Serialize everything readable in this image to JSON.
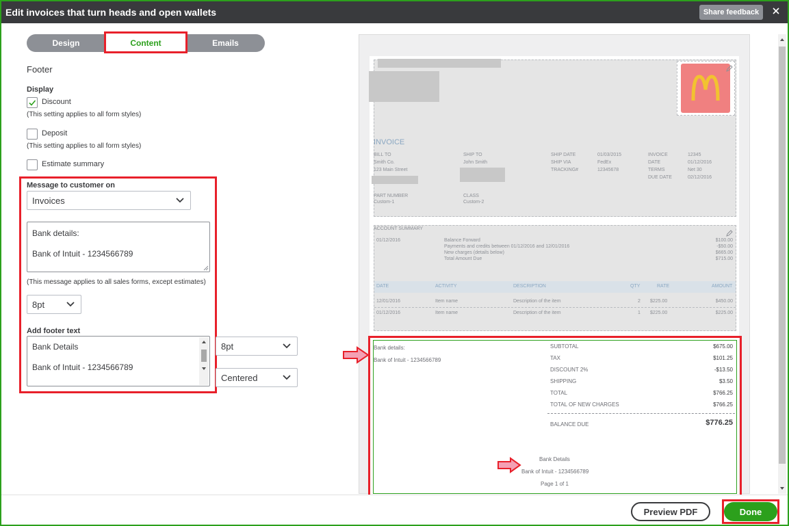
{
  "window": {
    "title": "Edit invoices that turn heads and open wallets",
    "share_feedback": "Share feedback",
    "close_icon": "close-icon"
  },
  "tabs": [
    {
      "label": "Design"
    },
    {
      "label": "Content",
      "active": true
    },
    {
      "label": "Emails"
    }
  ],
  "section": {
    "title": "Footer"
  },
  "display": {
    "heading": "Display",
    "discount": {
      "label": "Discount",
      "checked": true,
      "note": "(This setting applies to all form styles)"
    },
    "deposit": {
      "label": "Deposit",
      "checked": false,
      "note": "(This setting applies to all form styles)"
    },
    "estimate_summary": {
      "label": "Estimate summary",
      "checked": false
    }
  },
  "message": {
    "heading": "Message to customer on",
    "form_select": "Invoices",
    "text_line1": "Bank details:",
    "text_line2": "Bank of Intuit - 1234566789",
    "note": "(This message applies to all sales forms, except estimates)",
    "font_size": "8pt"
  },
  "footer_text": {
    "heading": "Add footer text",
    "line1": "Bank Details",
    "line2": "Bank of Intuit - 1234566789",
    "font_size": "8pt",
    "alignment": "Centered"
  },
  "preview": {
    "invoice_title": "INVOICE",
    "bill_to_label": "BILL TO",
    "bill_to_line1": "Smith Co.",
    "bill_to_line2": "123 Main Street",
    "ship_to_label": "SHIP TO",
    "ship_to_line1": "John Smith",
    "meta_labels": [
      "SHIP DATE",
      "SHIP VIA",
      "TRACKING#"
    ],
    "meta_values": [
      "01/03/2015",
      "FedEx",
      "12345678"
    ],
    "meta2_labels": [
      "INVOICE",
      "DATE",
      "TERMS",
      "DUE DATE"
    ],
    "meta2_values": [
      "12345",
      "01/12/2016",
      "Net 30",
      "02/12/2016"
    ],
    "part_number_label": "PART NUMBER",
    "part_number_value": "Custom-1",
    "class_label": "CLASS",
    "class_value": "Custom-2",
    "account_summary_label": "ACCOUNT SUMMARY",
    "summary_date": "01/12/2016",
    "summary_items": [
      {
        "label": "Balance Forward",
        "amount": "$100.00"
      },
      {
        "label": "Payments and credits between 01/12/2016 and 12/01/2016",
        "amount": "-$50.00"
      },
      {
        "label": "New charges (details below)",
        "amount": "$665.00"
      },
      {
        "label": "Total Amount Due",
        "amount": "$715.00"
      }
    ],
    "table_headers": [
      "DATE",
      "ACTIVITY",
      "DESCRIPTION",
      "QTY",
      "RATE",
      "AMOUNT"
    ],
    "table_rows": [
      {
        "date": "12/01/2016",
        "activity": "Item name",
        "description": "Description of the item",
        "qty": "2",
        "rate": "$225.00",
        "amount": "$450.00"
      },
      {
        "date": "01/12/2016",
        "activity": "Item name",
        "description": "Description of the item",
        "qty": "1",
        "rate": "$225.00",
        "amount": "$225.00"
      }
    ],
    "message_line1": "Bank details:",
    "message_line2": "Bank of Intuit - 1234566789",
    "totals": [
      {
        "label": "SUBTOTAL",
        "value": "$675.00"
      },
      {
        "label": "TAX",
        "value": "$101.25"
      },
      {
        "label": "DISCOUNT 2%",
        "value": "-$13.50"
      },
      {
        "label": "SHIPPING",
        "value": "$3.50"
      },
      {
        "label": "TOTAL",
        "value": "$766.25"
      },
      {
        "label": "TOTAL OF NEW CHARGES",
        "value": "$766.25"
      }
    ],
    "balance_due_label": "BALANCE DUE",
    "balance_due_value": "$776.25",
    "footer_line1": "Bank Details",
    "footer_line2": "Bank of Intuit - 1234566789",
    "page_label": "Page 1 of 1"
  },
  "buttons": {
    "preview_pdf": "Preview PDF",
    "done": "Done"
  },
  "colors": {
    "accent": "#2ca01c",
    "annotation": "#e8202a",
    "header_bg": "#393a3d",
    "arrow_fill": "#f4a0b4"
  }
}
